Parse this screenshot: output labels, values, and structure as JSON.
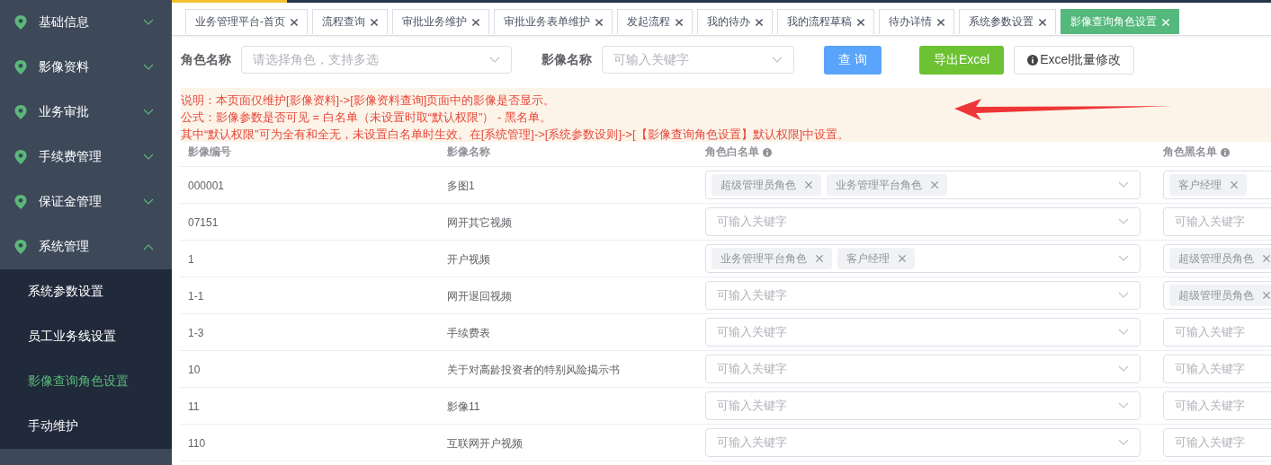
{
  "loading_bar": {
    "level": 0.105
  },
  "sidebar": {
    "items": [
      {
        "label": "基础信息",
        "expanded": false
      },
      {
        "label": "影像资料",
        "expanded": false
      },
      {
        "label": "业务审批",
        "expanded": false
      },
      {
        "label": "手续费管理",
        "expanded": false
      },
      {
        "label": "保证金管理",
        "expanded": false
      },
      {
        "label": "系统管理",
        "expanded": true,
        "children": [
          {
            "label": "系统参数设置",
            "selected": false
          },
          {
            "label": "员工业务线设置",
            "selected": false
          },
          {
            "label": "影像查询角色设置",
            "selected": true
          },
          {
            "label": "手动维护",
            "selected": false
          }
        ]
      }
    ]
  },
  "tabs": [
    {
      "label": "业务管理平台-首页",
      "selected": false
    },
    {
      "label": "流程查询",
      "selected": false
    },
    {
      "label": "审批业务维护",
      "selected": false
    },
    {
      "label": "审批业务表单维护",
      "selected": false
    },
    {
      "label": "发起流程",
      "selected": false
    },
    {
      "label": "我的待办",
      "selected": false
    },
    {
      "label": "我的流程草稿",
      "selected": false
    },
    {
      "label": "待办详情",
      "selected": false
    },
    {
      "label": "系统参数设置",
      "selected": false
    },
    {
      "label": "影像查询角色设置",
      "selected": true
    }
  ],
  "filters": [
    {
      "label": "角色名称",
      "placeholder": "请选择角色，支持多选"
    },
    {
      "label": "影像名称",
      "placeholder": "可输入关键字"
    }
  ],
  "buttons": [
    {
      "label": "查 询",
      "kind": "primary"
    },
    {
      "label": "导出Excel",
      "kind": "success"
    },
    {
      "label": "Excel批量修改",
      "kind": "info"
    }
  ],
  "notice": [
    "说明：本页面仅维护[影像资料]->[影像资料查询]页面中的影像是否显示。",
    "公式：影像参数是否可见 = 白名单（未设置时取“默认权限”） - 黑名单。",
    "其中“默认权限”可为全有和全无，未设置白名单时生效。在[系统管理]->[系统参数设则]->[【影像查询角色设置】默认权限]中设置。"
  ],
  "table": {
    "columns": [
      {
        "label": "影像编号",
        "info": false
      },
      {
        "label": "影像名称",
        "info": false
      },
      {
        "label": "角色白名单",
        "info": true
      },
      {
        "label": "角色黑名单",
        "info": true
      }
    ],
    "rows": [
      {
        "id": "000001",
        "name": "多图1",
        "whitelist": {
          "tags": [
            "超级管理员角色",
            "业务管理平台角色"
          ]
        },
        "blacklist": {
          "tags": [
            "客户经理"
          ]
        }
      },
      {
        "id": "07151",
        "name": "网开其它视频",
        "whitelist": {
          "placeholder": "可输入关键字"
        },
        "blacklist": {
          "placeholder": "可输入关键字"
        }
      },
      {
        "id": "1",
        "name": "开户视频",
        "whitelist": {
          "tags": [
            "业务管理平台角色",
            "客户经理"
          ]
        },
        "blacklist": {
          "tags": [
            "超级管理员角色"
          ]
        }
      },
      {
        "id": "1-1",
        "name": "网开退回视频",
        "whitelist": {
          "placeholder": "可输入关键字"
        },
        "blacklist": {
          "tags": [
            "超级管理员角色"
          ]
        }
      },
      {
        "id": "1-3",
        "name": "手续费表",
        "whitelist": {
          "placeholder": "可输入关键字"
        },
        "blacklist": {
          "placeholder": "可输入关键字"
        }
      },
      {
        "id": "10",
        "name": "关于对高龄投资者的特别风险揭示书",
        "whitelist": {
          "placeholder": "可输入关键字"
        },
        "blacklist": {
          "placeholder": "可输入关键字"
        }
      },
      {
        "id": "11",
        "name": "影像11",
        "whitelist": {
          "placeholder": "可输入关键字"
        },
        "blacklist": {
          "placeholder": "可输入关键字"
        }
      },
      {
        "id": "110",
        "name": "互联网开户视频",
        "whitelist": {
          "placeholder": "可输入关键字"
        },
        "blacklist": {
          "placeholder": "可输入关键字"
        }
      }
    ]
  }
}
